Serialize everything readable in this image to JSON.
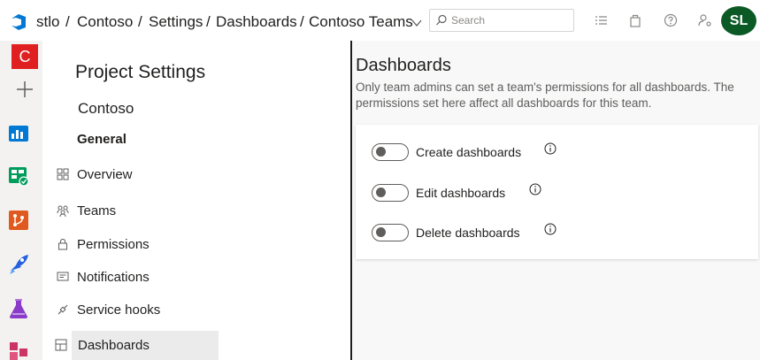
{
  "breadcrumb": {
    "org": "stlo",
    "project": "Contoso",
    "settings": "Settings",
    "dashboards": "Dashboards",
    "team": "Contoso Teams",
    "separator": "/"
  },
  "search": {
    "placeholder": "Search"
  },
  "user": {
    "initials": "SL",
    "avatar_color": "#0b5a26"
  },
  "project_badge": {
    "letter": "C",
    "color": "#e02020"
  },
  "nav": {
    "title": "Project Settings",
    "project_name": "Contoso",
    "section": "General",
    "items": [
      {
        "label": "Overview",
        "icon": "overview-icon"
      },
      {
        "label": "Teams",
        "icon": "teams-icon"
      },
      {
        "label": "Permissions",
        "icon": "lock-icon"
      },
      {
        "label": "Notifications",
        "icon": "notification-icon"
      },
      {
        "label": "Service hooks",
        "icon": "service-hooks-icon"
      },
      {
        "label": "Dashboards",
        "icon": "dashboards-icon",
        "selected": true
      }
    ]
  },
  "content": {
    "title": "Dashboards",
    "description": "Only team admins can set a team's permissions for all dashboards. The permissions set here affect all dashboards for this team.",
    "permissions": [
      {
        "label": "Create dashboards",
        "enabled": false
      },
      {
        "label": "Edit dashboards",
        "enabled": false
      },
      {
        "label": "Delete dashboards",
        "enabled": false
      }
    ]
  }
}
